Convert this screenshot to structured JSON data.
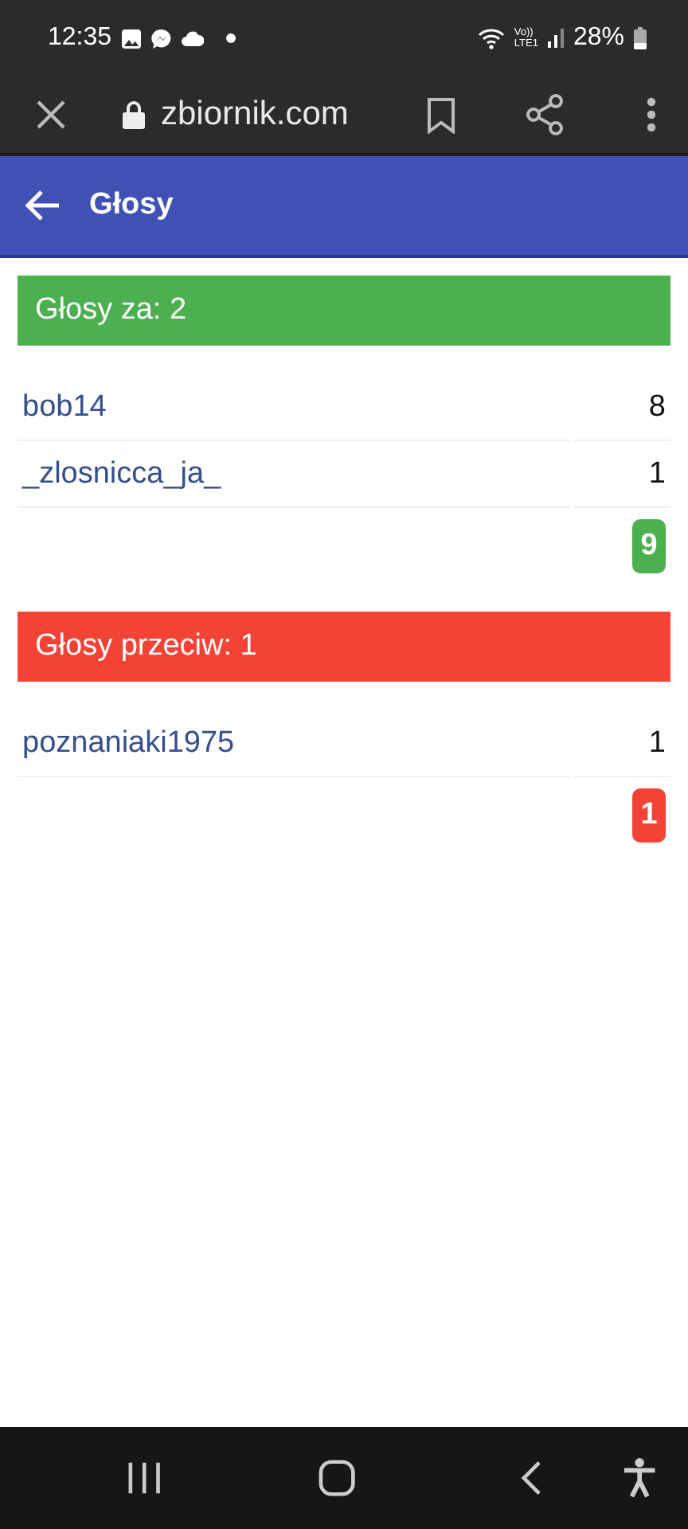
{
  "status_bar": {
    "time": "12:35",
    "volte": "Vo))",
    "lte": "LTE1",
    "battery": "28%"
  },
  "browser": {
    "url": "zbiornik.com"
  },
  "header": {
    "title": "Głosy"
  },
  "sections": [
    {
      "kind": "for",
      "title": "Głosy za: 2",
      "rows": [
        {
          "user": "bob14",
          "votes": "8"
        },
        {
          "user": "_zlosnicca_ja_",
          "votes": "1"
        }
      ],
      "total": "9"
    },
    {
      "kind": "against",
      "title": "Głosy przeciw: 1",
      "rows": [
        {
          "user": "poznaniaki1975",
          "votes": "1"
        }
      ],
      "total": "1"
    }
  ]
}
